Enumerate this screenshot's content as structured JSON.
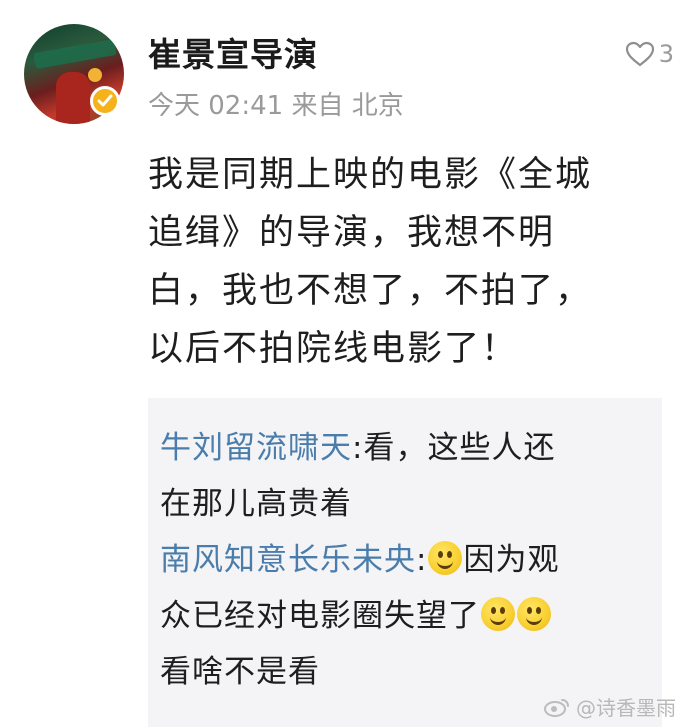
{
  "post": {
    "author": "崔景宣导演",
    "time": "今天 02:41",
    "source": "来自 北京",
    "like_count": "3",
    "content_lines": [
      "我是同期上映的电影《全城",
      "追缉》的导演，我想不明",
      "白，我也不想了，不拍了，",
      "以后不拍院线电影了！"
    ]
  },
  "comments": [
    {
      "name": "牛刘留流啸天",
      "lines": [
        "看，这些人还",
        "在那儿高贵着"
      ]
    },
    {
      "name": "南风知意长乐未央",
      "after_emoji": "因为观",
      "line2": "众已经对电影圈失望了",
      "line3": "看啥不是看"
    }
  ],
  "watermark": {
    "text": "@诗香墨雨"
  },
  "icons": {
    "like": "heart-outline-icon",
    "verified": "verified-badge-icon",
    "emoji": "smile-emoji-icon",
    "watermark": "weibo-logo-icon"
  },
  "colors": {
    "comment_name": "#4a7dab",
    "meta": "#9a9a9a",
    "comment_bg": "#f4f4f6",
    "verified": "#f5b21a"
  }
}
